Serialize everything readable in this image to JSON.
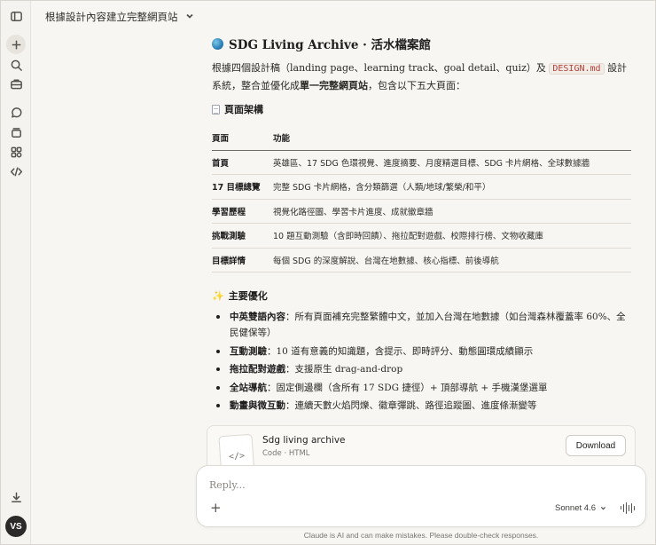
{
  "header": {
    "title": "根據設計內容建立完整網頁站"
  },
  "sidebar": {
    "buttons": [
      "sidebar-toggle-icon",
      "new-chat-icon",
      "search-icon",
      "projects-icon",
      "chats-icon",
      "artifacts-icon",
      "extensions-icon",
      "code-icon",
      "download-icon"
    ],
    "avatar": "VS"
  },
  "message": {
    "title": "SDG Living Archive · 活水檔案館",
    "intro_a": "根據四個設計稿（landing page、learning track、goal detail、quiz）及",
    "intro_code": "DESIGN.md",
    "intro_b": "設計系統，整合並優化成",
    "intro_bold": "單一完整網頁站",
    "intro_c": "，包含以下五大頁面：",
    "section1": "頁面架構",
    "table": {
      "headers": [
        "頁面",
        "功能"
      ],
      "rows": [
        [
          "首頁",
          "英雄區、17 SDG 色環視覺、進度摘要、月度精選目標、SDG 卡片網格、全球數據牆"
        ],
        [
          "17 目標總覽",
          "完整 SDG 卡片網格，含分類篩選（人類/地球/繁榮/和平）"
        ],
        [
          "學習歷程",
          "視覺化路徑圖、學習卡片進度、成就徽章牆"
        ],
        [
          "挑戰測驗",
          "10 題互動測驗（含即時回饋）、拖拉配對遊戲、校際排行榜、文物收藏庫"
        ],
        [
          "目標詳情",
          "每個 SDG 的深度解說、台灣在地數據、核心指標、前後導航"
        ]
      ]
    },
    "section2": "主要優化",
    "bullets": [
      {
        "bold": "中英雙語內容",
        "text": "：所有頁面補充完整繁體中文，並加入台灣在地數據（如台灣森林覆蓋率 60%、全民健保等）"
      },
      {
        "bold": "互動測驗",
        "text": "：10 道有意義的知識題，含提示、即時評分、動態圓環成績顯示"
      },
      {
        "bold": "拖拉配對遊戲",
        "text": "：支援原生 drag-and-drop"
      },
      {
        "bold": "全站導航",
        "text": "：固定側邊欄（含所有 17 SDG 捷徑）+ 頂部導航 + 手機漢堡選單"
      },
      {
        "bold": "動畫與微互動",
        "text": "：連續天數火焰閃爍、徽章彈跳、路徑追蹤圖、進度條漸變等"
      }
    ]
  },
  "artifact": {
    "title": "Sdg living archive",
    "subtitle": "Code · HTML",
    "thumb": "</>",
    "download_label": "Download"
  },
  "composer": {
    "placeholder": "Reply...",
    "model": "Sonnet 4.6"
  },
  "footer": {
    "disclaimer": "Claude is AI and can make mistakes. Please double-check responses."
  }
}
